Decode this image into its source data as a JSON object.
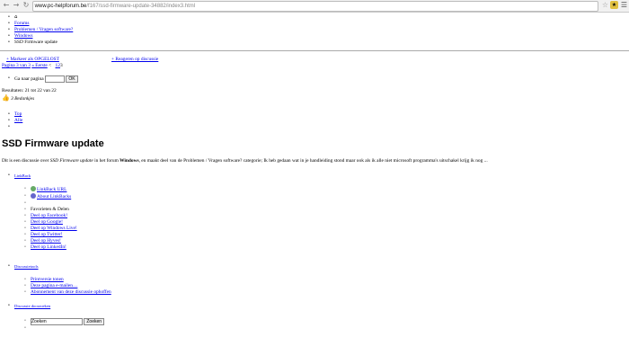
{
  "browser": {
    "url_host": "www.pc-helpforum.be",
    "url_path": "/f167/ssd-firmware-update-34882/index3.html"
  },
  "breadcrumb": {
    "home_icon": "home-icon",
    "items": [
      "Forums",
      "Problemen / Vragen software?",
      "Windows",
      "SSD Firmware update"
    ]
  },
  "actions": {
    "mark_solved": "+ Markeer als OPGELOST",
    "respond": "+ Reageren op discussie"
  },
  "pagination": {
    "page_of": "Pagina 3 van 3",
    "first": "« Eerste",
    "prev": "<",
    "pages": [
      "1",
      "2",
      "3"
    ]
  },
  "goto": {
    "label": "Ga naar pagina",
    "button": "OK"
  },
  "results": "Resultaten: 21 tot 22 van 22",
  "thanks": {
    "label": "3 Bedankjes"
  },
  "mode_links": [
    "Top",
    "Alle"
  ],
  "topic": {
    "title": "SSD Firmware update",
    "intro_prefix": "Dit is een discussie over ",
    "intro_topic": "SSD Firmware update",
    "intro_mid": " in het forum ",
    "intro_forum": "Windows",
    "intro_suffix": ", en maakt deel van de Problemen / Vragen software? categorie; Ik heb gedaan wat in je handleiding stond maar ook als ik alle niet microsoft programma's uitschakel krijg ik nog ..."
  },
  "linkback": {
    "heading": "LinkBack",
    "items": [
      "LinkBack URL",
      "About LinkBacks"
    ],
    "favorites_label": "Favorieten & Delen",
    "share": [
      "Deel op Facebook!",
      "Deel op Google!",
      "Deel op Windows Live!",
      "Deel op Twitter!",
      "Deel op Hyves!",
      "Deel op LinkedIn!"
    ]
  },
  "discussion_tools": {
    "heading": "Discussietools",
    "items": [
      "Printversie tonen",
      "Deze pagina e-mailen…",
      "Abonnement van deze discussie ophoffen"
    ]
  },
  "search": {
    "heading": "Discussie doorzoeken",
    "placeholder": "Zoeken",
    "button": "Zoeken"
  }
}
